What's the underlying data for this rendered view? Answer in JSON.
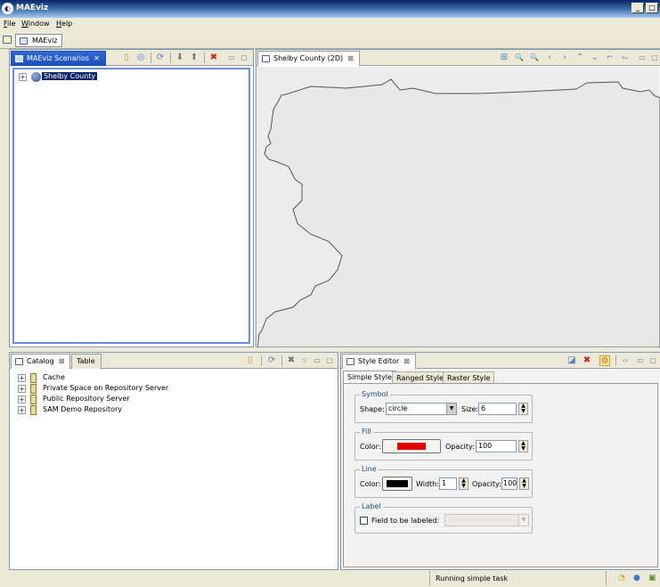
{
  "window": {
    "title": "MAEviz",
    "controls": {
      "minimize": "_",
      "maximize": "□"
    }
  },
  "menubar": {
    "items": [
      {
        "access": "F",
        "rest": "ile"
      },
      {
        "access": "W",
        "rest": "indow"
      },
      {
        "access": "H",
        "rest": "elp"
      }
    ]
  },
  "perspective": {
    "label": "MAEviz"
  },
  "scenarios": {
    "tab_label": "MAEviz Scenarios",
    "tab_close": "✕",
    "tree": [
      {
        "label": "Shelby County",
        "expander": "+"
      }
    ]
  },
  "map_view": {
    "tab_label": "Shelby County (2D)",
    "tab_close": "⊠",
    "tools": [
      "⊞",
      "🔍",
      "🔍",
      "‹",
      "›",
      "⌃",
      "⌄",
      "⌐",
      "⌙"
    ]
  },
  "catalog": {
    "tab_label": "Catalog",
    "tab_close": "⊠",
    "tab2_label": "Table",
    "items": [
      {
        "label": "Cache",
        "expander": "+"
      },
      {
        "label": "Private Space on Repository Server",
        "expander": "+"
      },
      {
        "label": "Public Repository Server",
        "expander": "+"
      },
      {
        "label": "SAM Demo Repository",
        "expander": "+"
      }
    ]
  },
  "style_editor": {
    "tab_label": "Style Editor",
    "tab_close": "⊠",
    "subtabs": [
      "Simple Style",
      "Ranged Style",
      "Raster Style"
    ],
    "symbol": {
      "legend": "Symbol",
      "shape_label": "Shape:",
      "shape_value": "circle",
      "size_label": "Size:",
      "size_value": "6"
    },
    "fill": {
      "legend": "Fill",
      "color_label": "Color:",
      "color": "#e00000",
      "opacity_label": "Opacity:",
      "opacity_value": "100"
    },
    "line": {
      "legend": "Line",
      "color_label": "Color:",
      "color": "#000000",
      "width_label": "Width:",
      "width_value": "1",
      "opacity_label": "Opacity:",
      "opacity_value": "100"
    },
    "label": {
      "legend": "Label",
      "field_label": "Field to be labeled:",
      "field_value": ""
    }
  },
  "status": {
    "text": "Running simple task"
  },
  "colors": {
    "accent": "#1c4fb8",
    "selection": "#0a246a",
    "map_bg": "#ececec"
  }
}
